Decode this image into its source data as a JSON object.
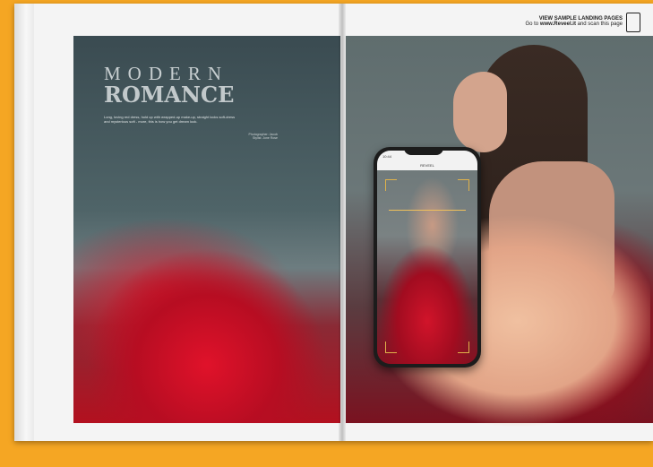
{
  "landing": {
    "cta_title": "VIEW SAMPLE LANDING PAGES",
    "cta_go": "Go to",
    "cta_url": "www.Reveel.it",
    "cta_rest": "and scan this page"
  },
  "magazine": {
    "title_small": "MODERN",
    "title_big": "ROMANCE",
    "intro": "Long, loving red dress, hold up with wrapped-up make-up, straight locks soft-dress and mysterious soft - more, this is how you get dream look.",
    "credit": "Photographer: Jacob\nStylist: Jone Rose"
  },
  "phone": {
    "time": "10:44",
    "app": "REVEEL"
  },
  "colors": {
    "background": "#f5a623",
    "accent_scan": "#e0b24a"
  },
  "icons": {
    "cta": "phone-scan-icon"
  }
}
